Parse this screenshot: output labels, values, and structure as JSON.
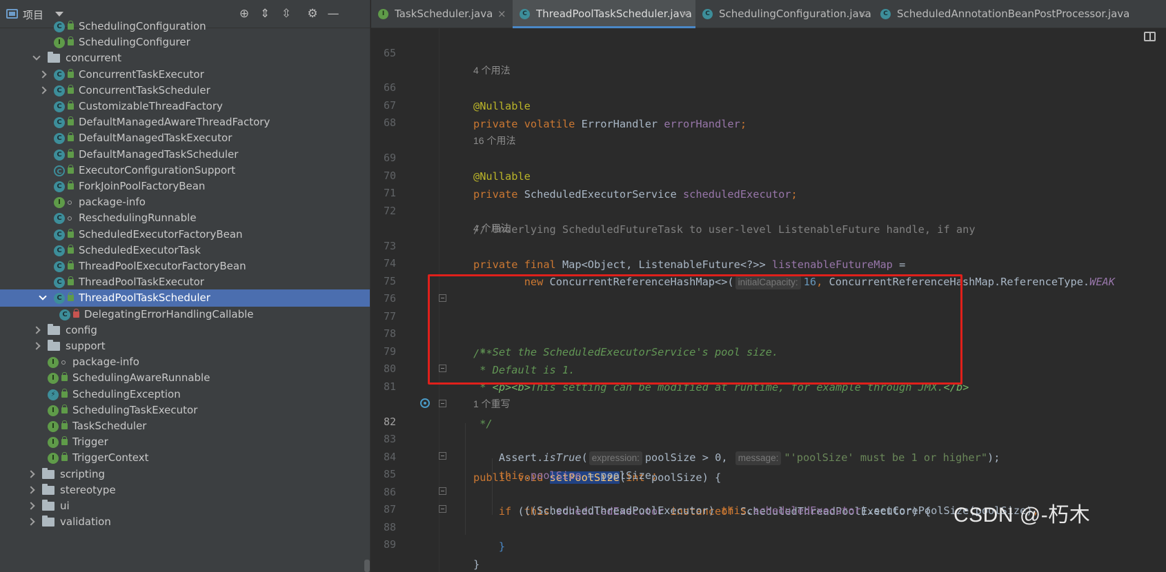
{
  "project_panel": {
    "title": "项目",
    "tree": [
      {
        "label": "SchedulingConfiguration",
        "kind": "C",
        "mod": "lock",
        "arrow": "",
        "depth": 2
      },
      {
        "label": "SchedulingConfigurer",
        "kind": "I",
        "mod": "lock",
        "arrow": "",
        "depth": 2
      },
      {
        "label": "concurrent",
        "kind": "folder",
        "mod": "",
        "arrow": "open",
        "depth": 1
      },
      {
        "label": "ConcurrentTaskExecutor",
        "kind": "C",
        "mod": "lock",
        "arrow": "closed",
        "depth": 2
      },
      {
        "label": "ConcurrentTaskScheduler",
        "kind": "C",
        "mod": "lock",
        "arrow": "closed",
        "depth": 2
      },
      {
        "label": "CustomizableThreadFactory",
        "kind": "C",
        "mod": "lock",
        "arrow": "",
        "depth": 2
      },
      {
        "label": "DefaultManagedAwareThreadFactory",
        "kind": "C",
        "mod": "lock",
        "arrow": "",
        "depth": 2
      },
      {
        "label": "DefaultManagedTaskExecutor",
        "kind": "C",
        "mod": "lock",
        "arrow": "",
        "depth": 2
      },
      {
        "label": "DefaultManagedTaskScheduler",
        "kind": "C",
        "mod": "lock",
        "arrow": "",
        "depth": 2
      },
      {
        "label": "ExecutorConfigurationSupport",
        "kind": "CA",
        "mod": "lock",
        "arrow": "",
        "depth": 2
      },
      {
        "label": "ForkJoinPoolFactoryBean",
        "kind": "C",
        "mod": "lock",
        "arrow": "",
        "depth": 2
      },
      {
        "label": "package-info",
        "kind": "I",
        "mod": "dot",
        "arrow": "",
        "depth": 2
      },
      {
        "label": "ReschedulingRunnable",
        "kind": "C",
        "mod": "dot",
        "arrow": "",
        "depth": 2
      },
      {
        "label": "ScheduledExecutorFactoryBean",
        "kind": "C",
        "mod": "lock",
        "arrow": "",
        "depth": 2
      },
      {
        "label": "ScheduledExecutorTask",
        "kind": "C",
        "mod": "lock",
        "arrow": "",
        "depth": 2
      },
      {
        "label": "ThreadPoolExecutorFactoryBean",
        "kind": "C",
        "mod": "lock",
        "arrow": "",
        "depth": 2
      },
      {
        "label": "ThreadPoolTaskExecutor",
        "kind": "C",
        "mod": "lock",
        "arrow": "",
        "depth": 2
      },
      {
        "label": "ThreadPoolTaskScheduler",
        "kind": "C",
        "mod": "lock",
        "arrow": "open",
        "depth": 2,
        "selected": true
      },
      {
        "label": "DelegatingErrorHandlingCallable",
        "kind": "C",
        "mod": "lock-red",
        "arrow": "",
        "depth": 3
      },
      {
        "label": "config",
        "kind": "folder",
        "mod": "",
        "arrow": "closed",
        "depth": 1
      },
      {
        "label": "support",
        "kind": "folder",
        "mod": "",
        "arrow": "closed",
        "depth": 1
      },
      {
        "label": "package-info",
        "kind": "I",
        "mod": "dot",
        "arrow": "",
        "depth": 1
      },
      {
        "label": "SchedulingAwareRunnable",
        "kind": "I",
        "mod": "lock",
        "arrow": "",
        "depth": 1
      },
      {
        "label": "SchedulingException",
        "kind": "E",
        "mod": "lock",
        "arrow": "",
        "depth": 1
      },
      {
        "label": "SchedulingTaskExecutor",
        "kind": "I",
        "mod": "lock",
        "arrow": "",
        "depth": 1
      },
      {
        "label": "TaskScheduler",
        "kind": "I",
        "mod": "lock",
        "arrow": "",
        "depth": 1
      },
      {
        "label": "Trigger",
        "kind": "I",
        "mod": "lock",
        "arrow": "",
        "depth": 1
      },
      {
        "label": "TriggerContext",
        "kind": "I",
        "mod": "lock",
        "arrow": "",
        "depth": 1
      },
      {
        "label": "scripting",
        "kind": "folder",
        "mod": "",
        "arrow": "closed",
        "depth": 0
      },
      {
        "label": "stereotype",
        "kind": "folder",
        "mod": "",
        "arrow": "closed",
        "depth": 0
      },
      {
        "label": "ui",
        "kind": "folder",
        "mod": "",
        "arrow": "closed",
        "depth": 0
      },
      {
        "label": "validation",
        "kind": "folder",
        "mod": "",
        "arrow": "closed",
        "depth": 0
      }
    ]
  },
  "tabs": [
    {
      "label": "TaskScheduler.java",
      "kind": "I",
      "active": false,
      "closable": true
    },
    {
      "label": "ThreadPoolTaskScheduler.java",
      "kind": "C",
      "active": true,
      "closable": true
    },
    {
      "label": "SchedulingConfiguration.java",
      "kind": "C",
      "active": false,
      "closable": true
    },
    {
      "label": "ScheduledAnnotationBeanPostProcessor.java",
      "kind": "C",
      "active": false,
      "closable": false
    }
  ],
  "hints": {
    "h1": "4 个用法",
    "h2": "16 个用法",
    "h3": "4 个用法",
    "h4": "1 个重写"
  },
  "code": {
    "l65": "65",
    "l66": "66",
    "l67": "67",
    "l68": "68",
    "l69": "69",
    "l70": "70",
    "l71": "71",
    "l72": "72",
    "l73": "73",
    "l74": "74",
    "l75": "75",
    "l76": "76",
    "l77": "77",
    "l78": "78",
    "l79": "79",
    "l80": "80",
    "l81": "81",
    "l82": "82",
    "l83": "83",
    "l84": "84",
    "l85": "85",
    "l86": "86",
    "l87": "87",
    "l88": "88",
    "l89": "89",
    "ann_nullable": "@Nullable",
    "kw_private": "private",
    "kw_volatile": "volatile",
    "kw_final": "final",
    "kw_new": "new",
    "kw_public": "public",
    "kw_void": "void",
    "kw_int": "int",
    "kw_this": "this",
    "kw_if": "if",
    "kw_instanceof": "instanceof",
    "t_errorhandler": "ErrorHandler",
    "f_errorhandler": "errorHandler",
    "t_ses": "ScheduledExecutorService",
    "f_scheduledexecutor": "scheduledExecutor",
    "c_line72": "// Underlying ScheduledFutureTask to user-level ListenableFuture handle, if any",
    "t_map": "Map<Object, ListenableFuture<?>>",
    "f_lfm": "listenableFutureMap",
    "t_crhm": "ConcurrentReferenceHashMap<>(",
    "p_initialcapacity": "initialCapacity:",
    "n_16": "16",
    "t_reftype": "ConcurrentReferenceHashMap.ReferenceType.",
    "f_weak": "WEAK",
    "doc77": "/**",
    "doc78": " * Set the ScheduledExecutorService's pool size.",
    "doc79": " * Default is 1.",
    "doc80_star": " * ",
    "doc80_tags": "<p><b>",
    "doc80_text": "This setting can be modified at runtime, for example through JMX.",
    "doc80_end": "</b>",
    "doc81": " */",
    "m_setpoolsize": "setPoolSize",
    "p_poolsize": "poolSize",
    "assert": "Assert.",
    "m_istrue": "isTrue",
    "p_expression": "expression:",
    "expr_cond": "poolSize > 0,",
    "p_message": "message:",
    "s_message": "\"'poolSize' must be 1 or higher\"",
    "f_poolsize": "poolSize",
    "t_stpe": "ScheduledThreadPoolExecutor",
    "m_setcore": "setCorePoolSize",
    "brace_open": "{",
    "brace_close": "}"
  },
  "watermark": "CSDN @-朽木"
}
